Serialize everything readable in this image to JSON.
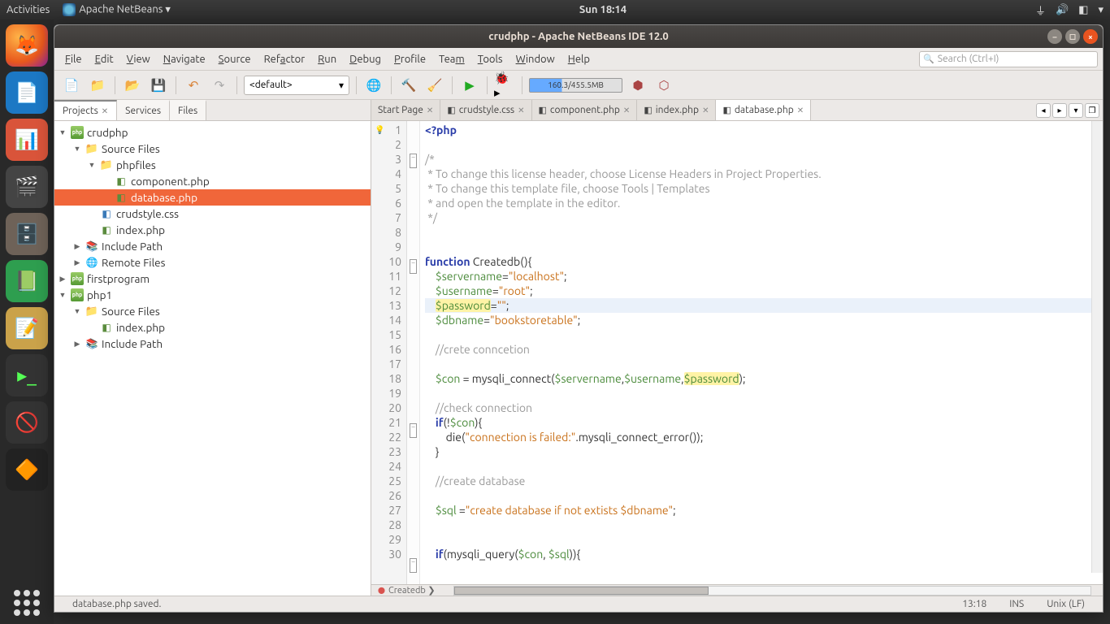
{
  "desktop": {
    "activities": "Activities",
    "app_menu": "Apache NetBeans ▾",
    "clock": "Sun 18:14"
  },
  "window": {
    "title": "crudphp - Apache NetBeans IDE 12.0"
  },
  "menu": {
    "file": "File",
    "edit": "Edit",
    "view": "View",
    "navigate": "Navigate",
    "source": "Source",
    "refactor": "Refactor",
    "run": "Run",
    "debug": "Debug",
    "profile": "Profile",
    "team": "Team",
    "tools": "Tools",
    "window_m": "Window",
    "help": "Help",
    "search_placeholder": "Search (Ctrl+I)"
  },
  "toolbar": {
    "config": "<default>",
    "memory": "160.3/455.5MB"
  },
  "sidebar": {
    "tabs": {
      "projects": "Projects",
      "services": "Services",
      "files": "Files"
    },
    "tree": [
      {
        "d": 0,
        "tw": "▼",
        "ico": "project",
        "label": "crudphp"
      },
      {
        "d": 1,
        "tw": "▼",
        "ico": "folder",
        "label": "Source Files"
      },
      {
        "d": 2,
        "tw": "▼",
        "ico": "folder",
        "label": "phpfiles"
      },
      {
        "d": 3,
        "tw": "",
        "ico": "php",
        "label": "component.php"
      },
      {
        "d": 3,
        "tw": "",
        "ico": "php",
        "label": "database.php",
        "sel": true
      },
      {
        "d": 2,
        "tw": "",
        "ico": "css",
        "label": "crudstyle.css"
      },
      {
        "d": 2,
        "tw": "",
        "ico": "php",
        "label": "index.php"
      },
      {
        "d": 1,
        "tw": "▶",
        "ico": "inc",
        "label": "Include Path"
      },
      {
        "d": 1,
        "tw": "▶",
        "ico": "remote",
        "label": "Remote Files"
      },
      {
        "d": 0,
        "tw": "▶",
        "ico": "project",
        "label": "firstprogram"
      },
      {
        "d": 0,
        "tw": "▼",
        "ico": "project",
        "label": "php1"
      },
      {
        "d": 1,
        "tw": "▼",
        "ico": "folder",
        "label": "Source Files"
      },
      {
        "d": 2,
        "tw": "",
        "ico": "php",
        "label": "index.php"
      },
      {
        "d": 1,
        "tw": "▶",
        "ico": "inc",
        "label": "Include Path"
      }
    ]
  },
  "editor_tabs": [
    {
      "label": "Start Page",
      "ico": "",
      "active": false
    },
    {
      "label": "crudstyle.css",
      "ico": "◧",
      "active": false
    },
    {
      "label": "component.php",
      "ico": "◧",
      "active": false
    },
    {
      "label": "index.php",
      "ico": "◧",
      "active": false
    },
    {
      "label": "database.php",
      "ico": "◧",
      "active": true
    }
  ],
  "code": {
    "lines": [
      {
        "n": 1,
        "bulb": true,
        "fold": "",
        "html": "<span class='tag'>&lt;?php</span>"
      },
      {
        "n": 2,
        "html": ""
      },
      {
        "n": 3,
        "fold": "-",
        "html": "<span class='comment'>/*</span>"
      },
      {
        "n": 4,
        "html": "<span class='comment'> * To change this license header, choose License Headers in Project Properties.</span>"
      },
      {
        "n": 5,
        "html": "<span class='comment'> * To change this template file, choose Tools | Templates</span>"
      },
      {
        "n": 6,
        "html": "<span class='comment'> * and open the template in the editor.</span>"
      },
      {
        "n": 7,
        "html": "<span class='comment'> */</span>"
      },
      {
        "n": 8,
        "html": ""
      },
      {
        "n": 9,
        "html": ""
      },
      {
        "n": 10,
        "fold": "-",
        "html": "<span class='kw'>function</span> <span class='fn'>Createdb</span>(){"
      },
      {
        "n": 11,
        "html": "    <span class='var'>$servername</span>=<span class='str'>\"localhost\"</span>;"
      },
      {
        "n": 12,
        "html": "    <span class='var'>$username</span>=<span class='str'>\"root\"</span>;"
      },
      {
        "n": 13,
        "hl": true,
        "html": "    <span class='var-hl'>$password</span>=<span class='str'>\"\"</span>;"
      },
      {
        "n": 14,
        "html": "    <span class='var'>$dbname</span>=<span class='str'>\"bookstoretable\"</span>;"
      },
      {
        "n": 15,
        "html": ""
      },
      {
        "n": 16,
        "html": "    <span class='comment'>//crete conncetion</span>"
      },
      {
        "n": 17,
        "html": ""
      },
      {
        "n": 18,
        "html": "    <span class='var'>$con</span> = mysqli_connect(<span class='var'>$servername</span>,<span class='var'>$username</span>,<span class='var-hl'>$password</span>);"
      },
      {
        "n": 19,
        "html": ""
      },
      {
        "n": 20,
        "html": "    <span class='comment'>//check connection</span>"
      },
      {
        "n": 21,
        "fold": "-",
        "html": "    <span class='kw'>if</span>(!<span class='var'>$con</span>){"
      },
      {
        "n": 22,
        "html": "        die(<span class='str'>\"connection is failed:\"</span>.mysqli_connect_error());"
      },
      {
        "n": 23,
        "html": "    }"
      },
      {
        "n": 24,
        "html": ""
      },
      {
        "n": 25,
        "html": "    <span class='comment'>//create database</span>"
      },
      {
        "n": 26,
        "html": ""
      },
      {
        "n": 27,
        "html": "    <span class='var'>$sql</span> =<span class='str'>\"create database if not extists $dbname\"</span>;"
      },
      {
        "n": 28,
        "html": ""
      },
      {
        "n": 29,
        "html": ""
      },
      {
        "n": 30,
        "fold": "-",
        "html": "    <span class='kw'>if</span>(mysqli_query(<span class='var'>$con</span>, <span class='var'>$sql</span>)){"
      }
    ],
    "breadcrumb": "Createdb ❯"
  },
  "status": {
    "message": "database.php saved.",
    "pos": "13:18",
    "mode": "INS",
    "encoding": "Unix (LF)"
  }
}
